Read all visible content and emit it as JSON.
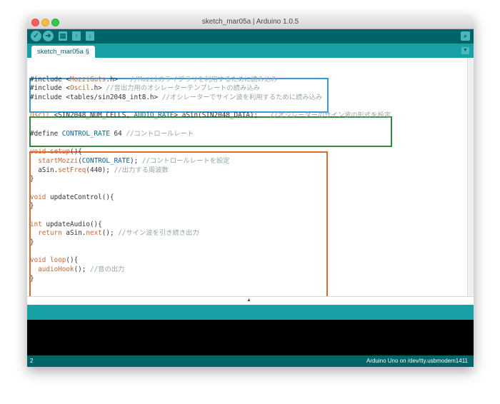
{
  "window": {
    "title": "sketch_mar05a | Arduino 1.0.5"
  },
  "toolbar": {
    "verify_icon": "check-icon",
    "upload_icon": "right-arrow-icon",
    "new_icon": "document-icon",
    "open_icon": "up-arrow-icon",
    "save_icon": "down-arrow-icon",
    "serial_icon": "magnifier-icon"
  },
  "tabs": [
    {
      "label": "sketch_mar05a §"
    }
  ],
  "code_lines": {
    "l1": {
      "a": "#include <",
      "b": "MozziGuts",
      "c": ".h>   ",
      "d": "//Mozziのライブラリを利用するために読み込み"
    },
    "l2": {
      "a": "#include <",
      "b": "Oscil",
      "c": ".h> ",
      "d": "//音出力用のオシレーターテンプレートの読み込み"
    },
    "l3": {
      "a": "#include <tables/sin2048_int8.h> ",
      "d": "//オシレーターでサイン波を利用するために読み込み"
    },
    "l4": {
      "a": "Oscil",
      "b": " <SIN2048_NUM_CELLS, ",
      "c": "AUDIO_RATE",
      "d": "> aSin(SIN2048_DATA);   ",
      "e": "//オシレーターのサイン波の形式を設定"
    },
    "l5": {
      "a": "#define ",
      "b": "CONTROL_RATE",
      "c": " 64 ",
      "d": "//コントロールレート"
    },
    "l6": {
      "a": "void",
      "b": " ",
      "c": "setup",
      "d": "(){"
    },
    "l7": {
      "a": "  ",
      "b": "startMozzi",
      "c": "(",
      "d": "CONTROL_RATE",
      "e": "); ",
      "f": "//コントロールレートを設定"
    },
    "l8": {
      "a": "  aSin.",
      "b": "setFreq",
      "c": "(440); ",
      "d": "//出力する周波数"
    },
    "l9": "}",
    "l10": {
      "a": "void",
      "b": " updateControl(){"
    },
    "l11": "}",
    "l12": {
      "a": "int",
      "b": " updateAudio(){"
    },
    "l13": {
      "a": "  ",
      "b": "return",
      "c": " aSin.",
      "d": "next",
      "e": "(); ",
      "f": "//サイン波を引き続き出力"
    },
    "l14": "}",
    "l15": {
      "a": "void",
      "b": " ",
      "c": "loop",
      "d": "(){"
    },
    "l16": {
      "a": "  ",
      "b": "audioHook",
      "c": "(); ",
      "d": "//音の出力"
    },
    "l17": "}"
  },
  "colors": {
    "blue_box": "#3a9ad9",
    "green_box": "#2e8b3a",
    "orange_box": "#e06a2a",
    "teal": "#006468"
  },
  "status": {
    "line_number": "2",
    "board": "Arduino Uno on /dev/tty.usbmodem1411"
  }
}
